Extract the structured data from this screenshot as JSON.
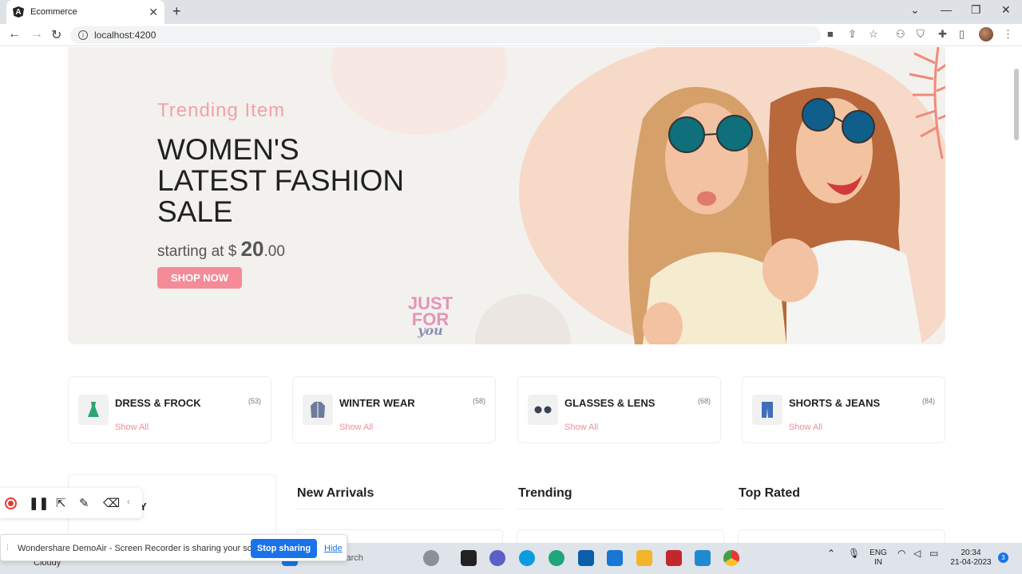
{
  "browser": {
    "tab_title": "Ecommerce",
    "url": "localhost:4200"
  },
  "hero": {
    "kicker": "Trending Item",
    "headline_1": "WOMEN'S",
    "headline_2": "LATEST FASHION",
    "headline_3": "SALE",
    "price_prefix": "starting at $",
    "price_whole": "20",
    "price_cents": ".00",
    "cta": "SHOP NOW",
    "badge_1": "JUST",
    "badge_2": "FOR",
    "badge_3": "you"
  },
  "categories": [
    {
      "name": "DRESS & FROCK",
      "count": "(53)",
      "link": "Show All",
      "icon": "dress-icon"
    },
    {
      "name": "WINTER WEAR",
      "count": "(58)",
      "link": "Show All",
      "icon": "jacket-icon"
    },
    {
      "name": "GLASSES & LENS",
      "count": "(68)",
      "link": "Show All",
      "icon": "glasses-icon"
    },
    {
      "name": "SHORTS & JEANS",
      "count": "(84)",
      "link": "Show All",
      "icon": "jeans-icon"
    }
  ],
  "sections": {
    "partial_label": "Y",
    "new_arrivals": "New Arrivals",
    "trending": "Trending",
    "top_rated": "Top Rated"
  },
  "share_bar": {
    "message": "Wondershare DemoAir - Screen Recorder is sharing your screen.",
    "stop": "Stop sharing",
    "hide": "Hide"
  },
  "taskbar": {
    "weather": "Cloudy",
    "search": "Search",
    "lang_1": "ENG",
    "lang_2": "IN",
    "time": "20:34",
    "date": "21-04-2023",
    "notifications": "3"
  },
  "colors": {
    "accent": "#f58b98",
    "kicker": "#f3a0a8",
    "share_button": "#1a73e8"
  }
}
